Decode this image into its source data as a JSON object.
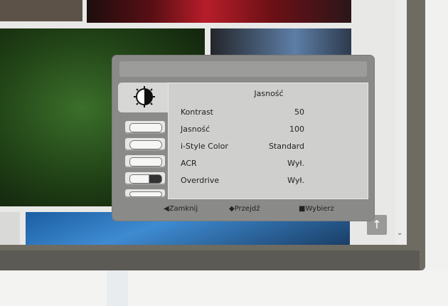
{
  "osd": {
    "title": "Jasność",
    "settings": [
      {
        "label": "Kontrast",
        "value": "50"
      },
      {
        "label": "Jasność",
        "value": "100"
      },
      {
        "label": "i-Style Color",
        "value": "Standard"
      },
      {
        "label": "ACR",
        "value": "Wył."
      },
      {
        "label": "Overdrive",
        "value": "Wył."
      }
    ],
    "footer": {
      "close": "Zamknij",
      "move": "Przejdź",
      "select": "Wybierz"
    },
    "tab_icons": [
      "brightness-icon",
      "picture-icon",
      "auto-adjust-icon",
      "image-setup-icon",
      "color-icon",
      "osd-setup-icon"
    ]
  },
  "colors": {
    "bezel": "#6e6b63",
    "osd_bg": "#8a8a88",
    "panel_bg": "#cfcfcd"
  },
  "scroll": {
    "up_icon": "arrow-up-icon",
    "down_icon": "chevron-down-icon"
  }
}
